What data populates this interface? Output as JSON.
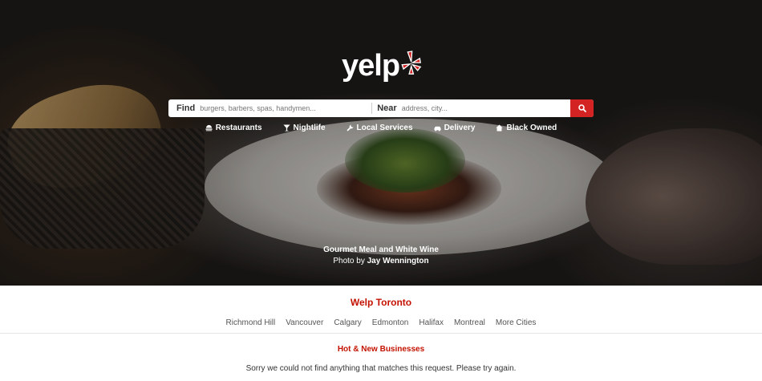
{
  "header": {
    "logo_text": "yelp",
    "logo_icon": "yelp-burst-icon",
    "brand_color": "#d32323"
  },
  "search": {
    "find_label": "Find",
    "find_placeholder": "burgers, barbers, spas, handymen...",
    "near_label": "Near",
    "near_placeholder": "address, city...",
    "button_icon": "search-icon"
  },
  "categories": [
    {
      "label": "Restaurants",
      "icon": "restaurant-icon"
    },
    {
      "label": "Nightlife",
      "icon": "cocktail-icon"
    },
    {
      "label": "Local Services",
      "icon": "wrench-icon"
    },
    {
      "label": "Delivery",
      "icon": "car-icon"
    },
    {
      "label": "Black Owned",
      "icon": "home-icon"
    }
  ],
  "hero_caption": {
    "title": "Gourmet Meal and White Wine",
    "credit_prefix": "Photo by",
    "credit_name": "Jay Wennington"
  },
  "cities": {
    "title": "Welp Toronto",
    "items": [
      "Richmond Hill",
      "Vancouver",
      "Calgary",
      "Edmonton",
      "Halifax",
      "Montreal",
      "More Cities"
    ]
  },
  "hot_new": {
    "title": "Hot & New Businesses",
    "message": "Sorry we could not find anything that matches this request. Please try again."
  }
}
